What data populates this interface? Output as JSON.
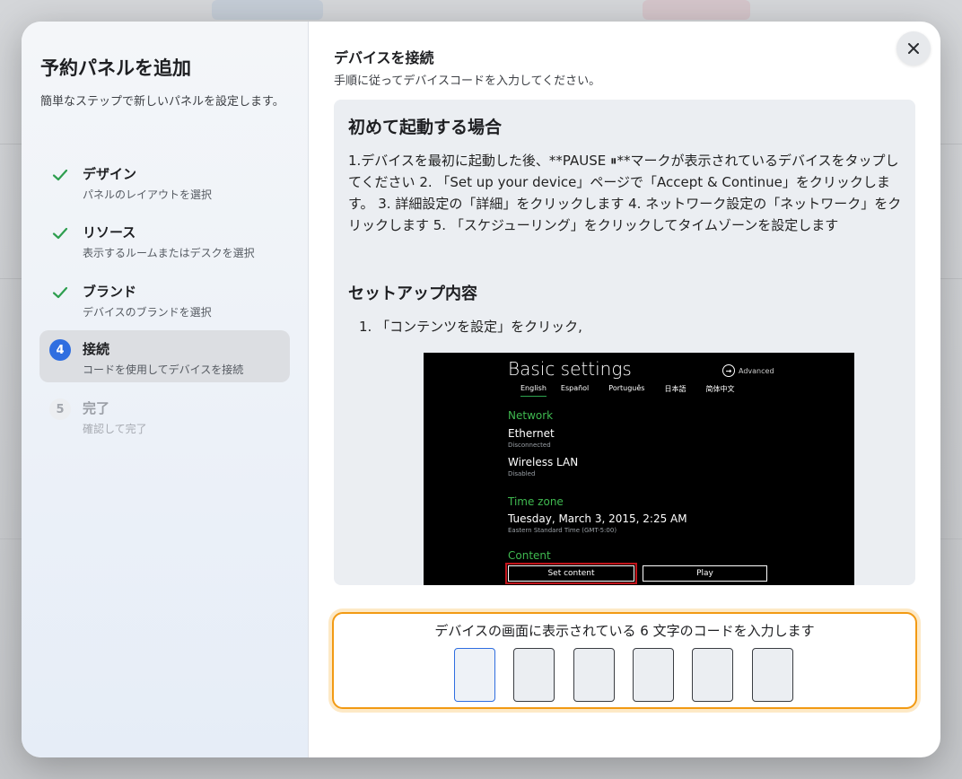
{
  "sidebar": {
    "title": "予約パネルを追加",
    "subtitle": "簡単なステップで新しいパネルを設定します。",
    "steps": [
      {
        "label": "デザイン",
        "desc": "パネルのレイアウトを選択",
        "status": "done"
      },
      {
        "label": "リソース",
        "desc": "表示するルームまたはデスクを選択",
        "status": "done"
      },
      {
        "label": "ブランド",
        "desc": "デバイスのブランドを選択",
        "status": "done"
      },
      {
        "num": "4",
        "label": "接続",
        "desc": "コードを使用してデバイスを接続",
        "status": "active"
      },
      {
        "num": "5",
        "label": "完了",
        "desc": "確認して完了",
        "status": "pending"
      }
    ]
  },
  "main": {
    "title": "デバイスを接続",
    "subtitle": "手順に従ってデバイスコードを入力してください。",
    "close_icon": "close-icon"
  },
  "instructions": {
    "heading": "初めて起動する場合",
    "paragraph": "1.デバイスを最初に起動した後、**PAUSE ⏸**マークが表示されているデバイスをタップしてください 2. 「Set up your device」ページで「Accept & Continue」をクリックします。 3. 詳細設定の「詳細」をクリックします 4. ネットワーク設定の「ネットワーク」をクリックします 5. 「スケジューリング」をクリックしてタイムゾーンを設定します",
    "setup_heading": "セットアップ内容",
    "list_item_1": "1. 「コンテンツを設定」をクリック,"
  },
  "screenshot": {
    "title": "Basic settings",
    "advanced": "Advanced",
    "languages": [
      "English",
      "Español",
      "Português",
      "日本語",
      "简体中文"
    ],
    "network_label": "Network",
    "ethernet": "Ethernet",
    "ethernet_status": "Disconnected",
    "wireless": "Wireless LAN",
    "wireless_status": "Disabled",
    "timezone_label": "Time zone",
    "datetime": "Tuesday, March 3, 2015, 2:25 AM",
    "timezone": "Eastern Standard Time (GMT-5:00)",
    "content_label": "Content",
    "set_content": "Set content",
    "play": "Play"
  },
  "code_entry": {
    "label": "デバイスの画面に表示されている 6 文字のコードを入力します",
    "digits": [
      "",
      "",
      "",
      "",
      "",
      ""
    ]
  },
  "colors": {
    "accent": "#2f6ee0",
    "check": "#2e9e4f",
    "highlight_border": "#f29a13"
  }
}
